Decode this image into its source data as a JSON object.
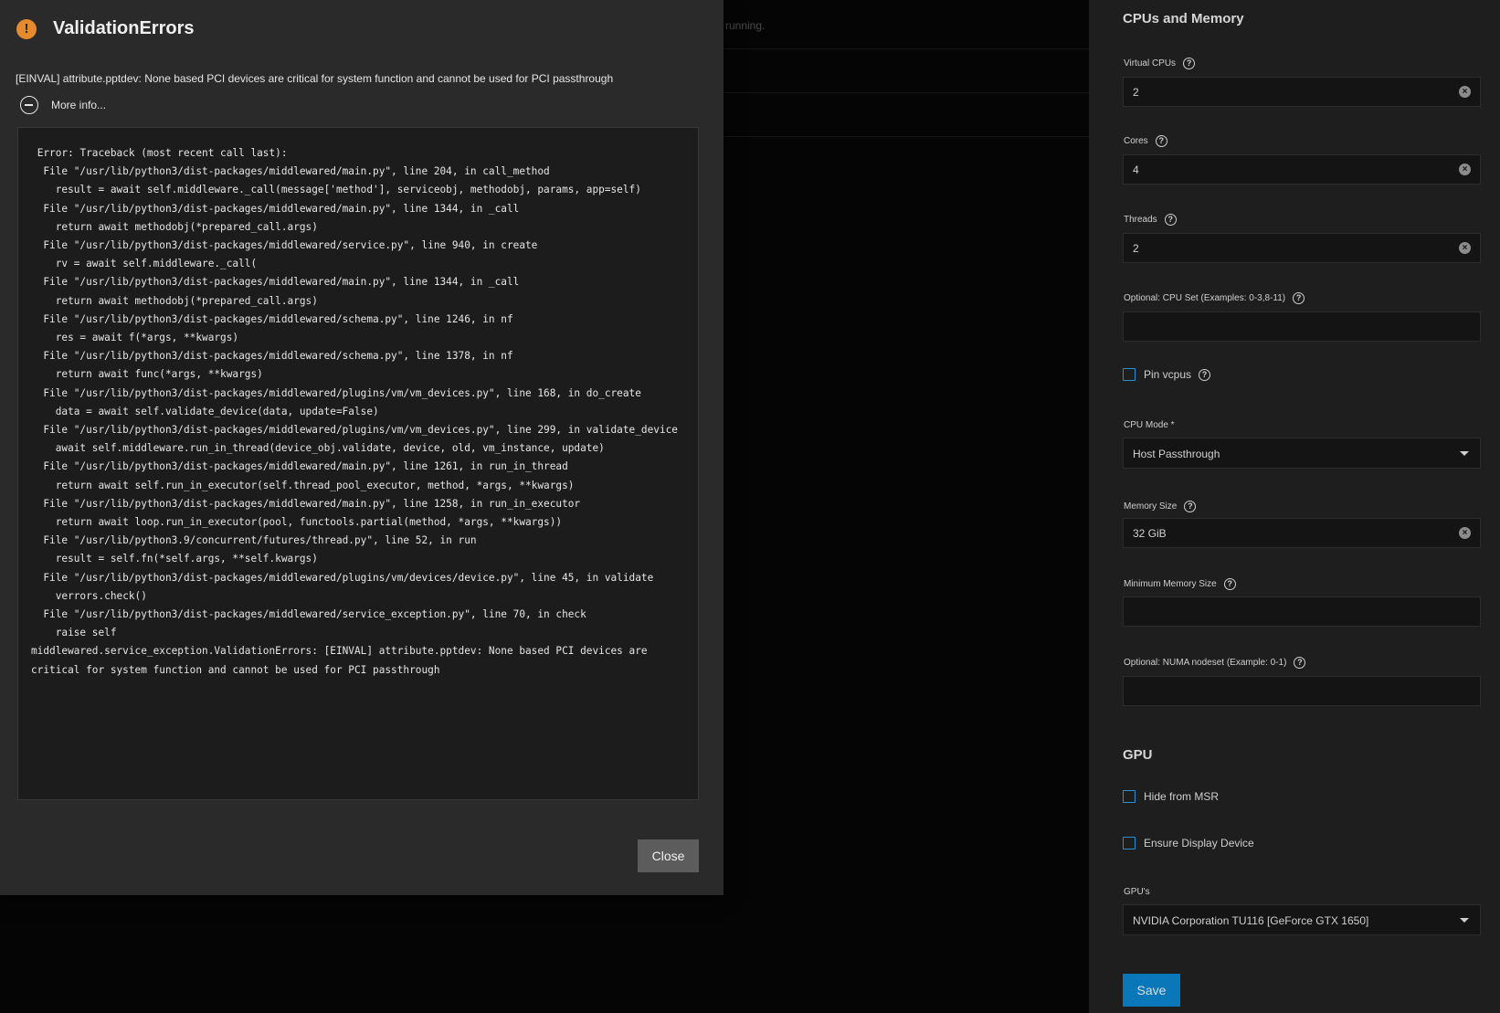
{
  "background": {
    "status_text": "running."
  },
  "dialog": {
    "title": "ValidationErrors",
    "message": "[EINVAL] attribute.pptdev: None based PCI devices are critical for system function and cannot be used for PCI passthrough",
    "more_info_label": "More info...",
    "traceback": " Error: Traceback (most recent call last):\n  File \"/usr/lib/python3/dist-packages/middlewared/main.py\", line 204, in call_method\n    result = await self.middleware._call(message['method'], serviceobj, methodobj, params, app=self)\n  File \"/usr/lib/python3/dist-packages/middlewared/main.py\", line 1344, in _call\n    return await methodobj(*prepared_call.args)\n  File \"/usr/lib/python3/dist-packages/middlewared/service.py\", line 940, in create\n    rv = await self.middleware._call(\n  File \"/usr/lib/python3/dist-packages/middlewared/main.py\", line 1344, in _call\n    return await methodobj(*prepared_call.args)\n  File \"/usr/lib/python3/dist-packages/middlewared/schema.py\", line 1246, in nf\n    res = await f(*args, **kwargs)\n  File \"/usr/lib/python3/dist-packages/middlewared/schema.py\", line 1378, in nf\n    return await func(*args, **kwargs)\n  File \"/usr/lib/python3/dist-packages/middlewared/plugins/vm/vm_devices.py\", line 168, in do_create\n    data = await self.validate_device(data, update=False)\n  File \"/usr/lib/python3/dist-packages/middlewared/plugins/vm/vm_devices.py\", line 299, in validate_device\n    await self.middleware.run_in_thread(device_obj.validate, device, old, vm_instance, update)\n  File \"/usr/lib/python3/dist-packages/middlewared/main.py\", line 1261, in run_in_thread\n    return await self.run_in_executor(self.thread_pool_executor, method, *args, **kwargs)\n  File \"/usr/lib/python3/dist-packages/middlewared/main.py\", line 1258, in run_in_executor\n    return await loop.run_in_executor(pool, functools.partial(method, *args, **kwargs))\n  File \"/usr/lib/python3.9/concurrent/futures/thread.py\", line 52, in run\n    result = self.fn(*self.args, **self.kwargs)\n  File \"/usr/lib/python3/dist-packages/middlewared/plugins/vm/devices/device.py\", line 45, in validate\n    verrors.check()\n  File \"/usr/lib/python3/dist-packages/middlewared/service_exception.py\", line 70, in check\n    raise self\nmiddlewared.service_exception.ValidationErrors: [EINVAL] attribute.pptdev: None based PCI devices are critical for system function and cannot be used for PCI passthrough",
    "close_label": "Close"
  },
  "panel": {
    "cpu_section_title": "CPUs and Memory",
    "virtual_cpus": {
      "label": "Virtual CPUs",
      "value": "2"
    },
    "cores": {
      "label": "Cores",
      "value": "4"
    },
    "threads": {
      "label": "Threads",
      "value": "2"
    },
    "cpu_set": {
      "label": "Optional: CPU Set (Examples: 0-3,8-11)",
      "value": ""
    },
    "pin_vcpus": {
      "label": "Pin vcpus",
      "checked": false
    },
    "cpu_mode": {
      "label": "CPU Mode *",
      "value": "Host Passthrough"
    },
    "memory_size": {
      "label": "Memory Size",
      "value": "32 GiB"
    },
    "min_memory_size": {
      "label": "Minimum Memory Size",
      "value": ""
    },
    "numa_nodeset": {
      "label": "Optional: NUMA nodeset (Example: 0-1)",
      "value": ""
    },
    "gpu_section_title": "GPU",
    "hide_from_msr": {
      "label": "Hide from MSR",
      "checked": false
    },
    "ensure_display_device": {
      "label": "Ensure Display Device",
      "checked": false
    },
    "gpus": {
      "label": "GPU's",
      "value": "NVIDIA Corporation TU116 [GeForce GTX 1650]"
    },
    "save_label": "Save"
  },
  "colors": {
    "accent": "#0a78b8",
    "warning": "#e58a2e",
    "dialog_bg": "#2a2a2a",
    "panel_bg": "#1e1e1e"
  }
}
